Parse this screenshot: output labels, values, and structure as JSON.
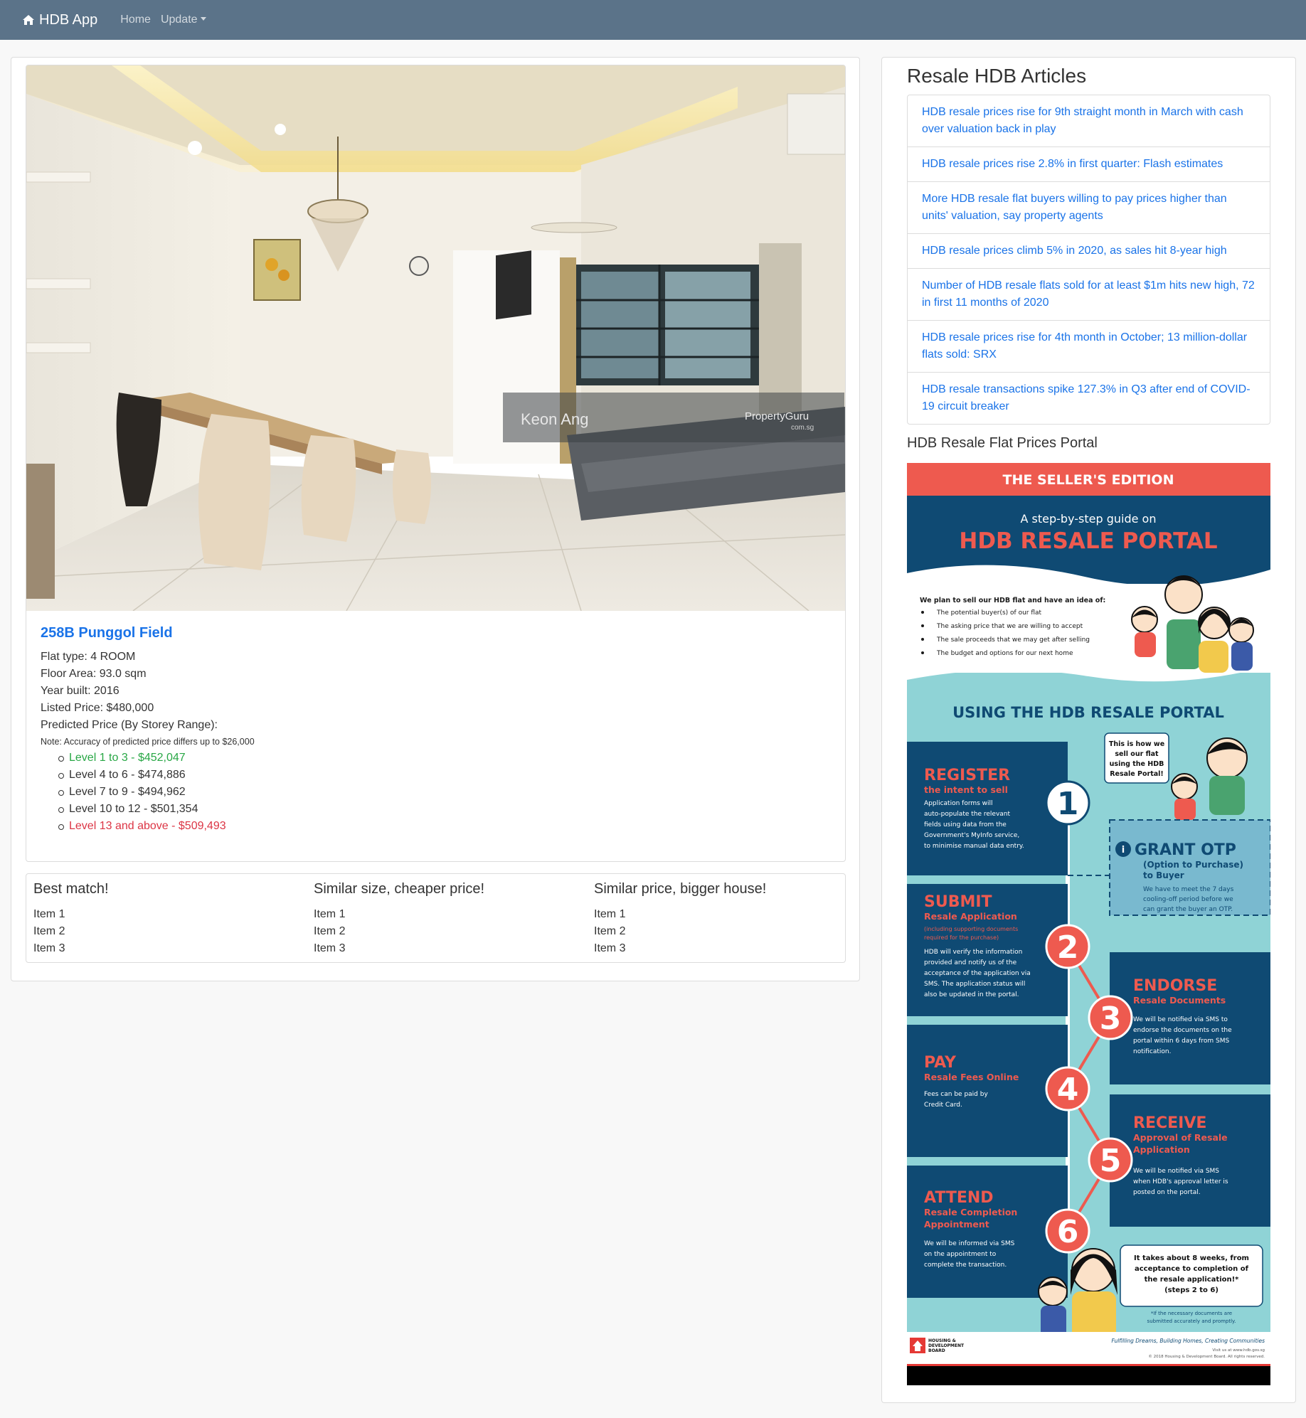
{
  "navbar": {
    "brand": "HDB App",
    "links": [
      {
        "label": "Home"
      },
      {
        "label": "Update"
      }
    ]
  },
  "listing": {
    "photo_watermark": "Keon Ang",
    "photo_logo": "PropertyGuru",
    "photo_logo_sub": "com.sg",
    "address": "258B Punggol Field",
    "flat_type": "Flat type: 4 ROOM",
    "floor_area": "Floor Area: 93.0 sqm",
    "year_built": "Year built: 2016",
    "listed_price": "Listed Price: $480,000",
    "predicted_heading": "Predicted Price (By Storey Range):",
    "note": "Note: Accuracy of predicted price differs up to $26,000",
    "levels": [
      "Level 1 to 3 - $452,047",
      "Level 4 to 6 - $474,886",
      "Level 7 to 9 - $494,962",
      "Level 10 to 12 - $501,354",
      "Level 13 and above - $509,493"
    ],
    "level_colors": {
      "lowest": "#28a745",
      "highest": "#dc3545"
    }
  },
  "similar": [
    {
      "title": "Best match!",
      "items": [
        "Item 1",
        "Item 2",
        "Item 3"
      ]
    },
    {
      "title": "Similar size, cheaper price!",
      "items": [
        "Item 1",
        "Item 2",
        "Item 3"
      ]
    },
    {
      "title": "Similar price, bigger house!",
      "items": [
        "Item 1",
        "Item 2",
        "Item 3"
      ]
    }
  ],
  "sidebar": {
    "title": "Resale HDB Articles",
    "articles": [
      "HDB resale prices rise for 9th straight month in March with cash over valuation back in play",
      "HDB resale prices rise 2.8% in first quarter: Flash estimates",
      "More HDB resale flat buyers willing to pay prices higher than units' valuation, say property agents",
      "HDB resale prices climb 5% in 2020, as sales hit 8-year high",
      "Number of HDB resale flats sold for at least $1m hits new high, 72 in first 11 months of 2020",
      "HDB resale prices rise for 4th month in October; 13 million-dollar flats sold: SRX",
      "HDB resale transactions spike 127.3% in Q3 after end of COVID-19 circuit breaker"
    ],
    "portal_title": "HDB Resale Flat Prices Portal"
  },
  "infographic": {
    "banner": "THE SELLER'S EDITION",
    "subtitle": "A step-by-step guide on",
    "title": "HDB RESALE PORTAL",
    "intro": "We plan to sell our HDB flat and have an idea of:",
    "bullets": [
      "The potential buyer(s) of our flat",
      "The asking price that we are willing to accept",
      "The sale proceeds that we may get after selling",
      "The budget and options for our next home"
    ],
    "section": "USING THE HDB RESALE PORTAL",
    "speech1": [
      "This is how we",
      "sell our flat",
      "using the HDB",
      "Resale Portal!"
    ],
    "steps": [
      {
        "n": "1",
        "title": "REGISTER",
        "sub": "the intent to sell",
        "body": [
          "Application forms will",
          "auto-populate the relevant",
          "fields using data from the",
          "Government's MyInfo service,",
          "to minimise manual data entry."
        ]
      },
      {
        "n": "i",
        "title": "GRANT OTP",
        "sub": "(Option to Purchase)",
        "sub2": "to Buyer",
        "body": [
          "We have to meet the 7 days",
          "cooling-off period before we",
          "can grant the buyer an OTP."
        ]
      },
      {
        "n": "2",
        "title": "SUBMIT",
        "sub": "Resale Application",
        "small": [
          "(including supporting documents",
          "required for the purchase)"
        ],
        "body": [
          "HDB will verify the information",
          "provided and notify us of the",
          "acceptance of the application via",
          "SMS. The application status will",
          "also be updated in the portal."
        ]
      },
      {
        "n": "3",
        "title": "ENDORSE",
        "sub": "Resale Documents",
        "body": [
          "We will be notified via SMS to",
          "endorse the documents on the",
          "portal within 6 days from SMS",
          "notification."
        ]
      },
      {
        "n": "4",
        "title": "PAY",
        "sub": "Resale Fees Online",
        "body": [
          "Fees can be paid by",
          "Credit Card."
        ]
      },
      {
        "n": "5",
        "title": "RECEIVE",
        "sub": "Approval of Resale",
        "sub2": "Application",
        "body": [
          "We will be notified via SMS",
          "when HDB's approval letter is",
          "posted on the portal."
        ]
      },
      {
        "n": "6",
        "title": "ATTEND",
        "sub": "Resale Completion",
        "sub2": "Appointment",
        "body": [
          "We will be informed via SMS",
          "on the appointment to",
          "complete the transaction."
        ]
      }
    ],
    "speech2": [
      "It takes about 8 weeks, from",
      "acceptance to completion of",
      "the resale application!*",
      "(steps 2 to 6)"
    ],
    "footnote": [
      "*If the necessary documents are",
      "submitted accurately and promptly."
    ],
    "footer_org": [
      "HOUSING &",
      "DEVELOPMENT",
      "BOARD"
    ],
    "footer_tagline": "Fulfilling Dreams, Building Homes, Creating Communities",
    "footer_visit": "Visit us at www.hdb.gov.sg",
    "footer_copy": "© 2018 Housing & Development Board. All rights reserved.",
    "colors": {
      "navy": "#0f4a73",
      "coral": "#ee5a4f",
      "teal": "#8fd3d6"
    }
  }
}
